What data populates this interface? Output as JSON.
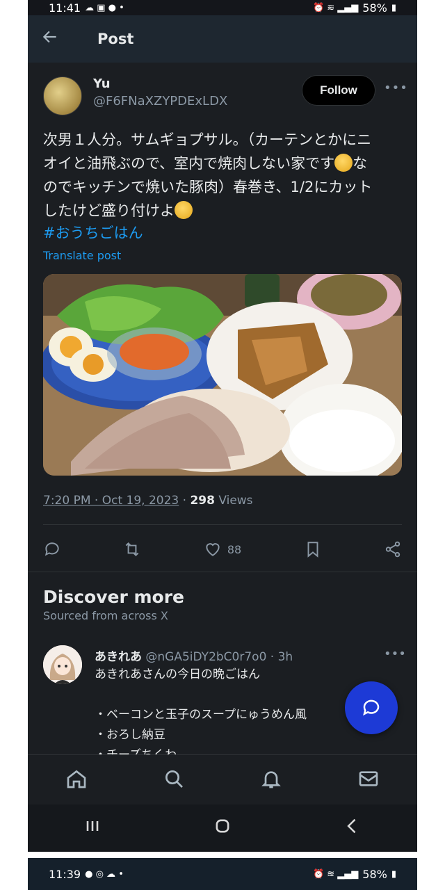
{
  "status_bar_top": {
    "time": "11:41",
    "battery": "58%"
  },
  "status_bar_bottom": {
    "time": "11:39",
    "battery": "58%"
  },
  "header": {
    "title": "Post"
  },
  "post": {
    "author_name": "Yu",
    "author_handle": "@F6FNaXZYPDExLDX",
    "follow_label": "Follow",
    "text_line1": "次男１人分。サムギョプサル。（カーテンとかにニ",
    "text_line2a": "オイと油飛ぶので、室内で焼肉しない家です",
    "text_line2b": "な",
    "text_line3": "のでキッチンで焼いた豚肉）春巻き、1/2にカット",
    "text_line4": "したけど盛り付けよ",
    "hashtag": "#おうちごはん",
    "translate_label": "Translate post",
    "timestamp": "7:20 PM · Oct 19, 2023",
    "views_count": "298",
    "views_label": "Views",
    "like_count": "88"
  },
  "discover": {
    "title": "Discover more",
    "subtitle": "Sourced from across X"
  },
  "recommended": {
    "name": "あきれあ",
    "handle_time": "@nGA5iDY2bC0r7o0 · 3h",
    "line1": "あきれあさんの今日の晩ごはん",
    "line2": "・ベーコンと玉子のスープにゅうめん風",
    "line3": "・おろし納豆",
    "line4": "・チーズちくわ"
  },
  "icons": {
    "back": "arrow-left-icon",
    "reply": "reply-icon",
    "repost": "repost-icon",
    "like": "heart-icon",
    "bookmark": "bookmark-icon",
    "share": "share-icon",
    "home": "home-icon",
    "search": "search-icon",
    "notifications": "bell-icon",
    "messages": "mail-icon",
    "compose": "compose-icon"
  },
  "colors": {
    "background": "#1b1e22",
    "accent": "#1d9bf0",
    "fab": "#1d3ad6",
    "muted": "#8b98a5"
  }
}
